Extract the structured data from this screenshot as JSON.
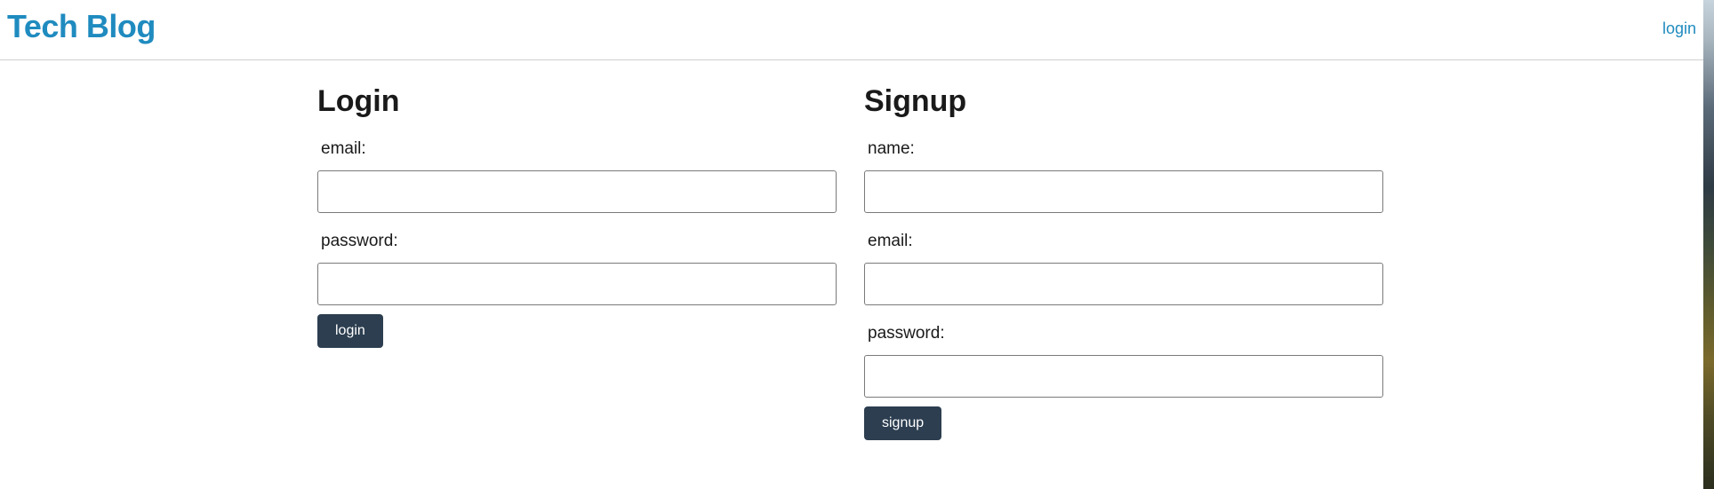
{
  "header": {
    "brand": "Tech Blog",
    "nav_login": "login"
  },
  "login_form": {
    "title": "Login",
    "email_label": "email:",
    "email_value": "",
    "password_label": "password:",
    "password_value": "",
    "submit_label": "login"
  },
  "signup_form": {
    "title": "Signup",
    "name_label": "name:",
    "name_value": "",
    "email_label": "email:",
    "email_value": "",
    "password_label": "password:",
    "password_value": "",
    "submit_label": "signup"
  },
  "colors": {
    "brand": "#1f8bbf",
    "button_bg": "#2c3e50",
    "button_text": "#ffffff"
  }
}
